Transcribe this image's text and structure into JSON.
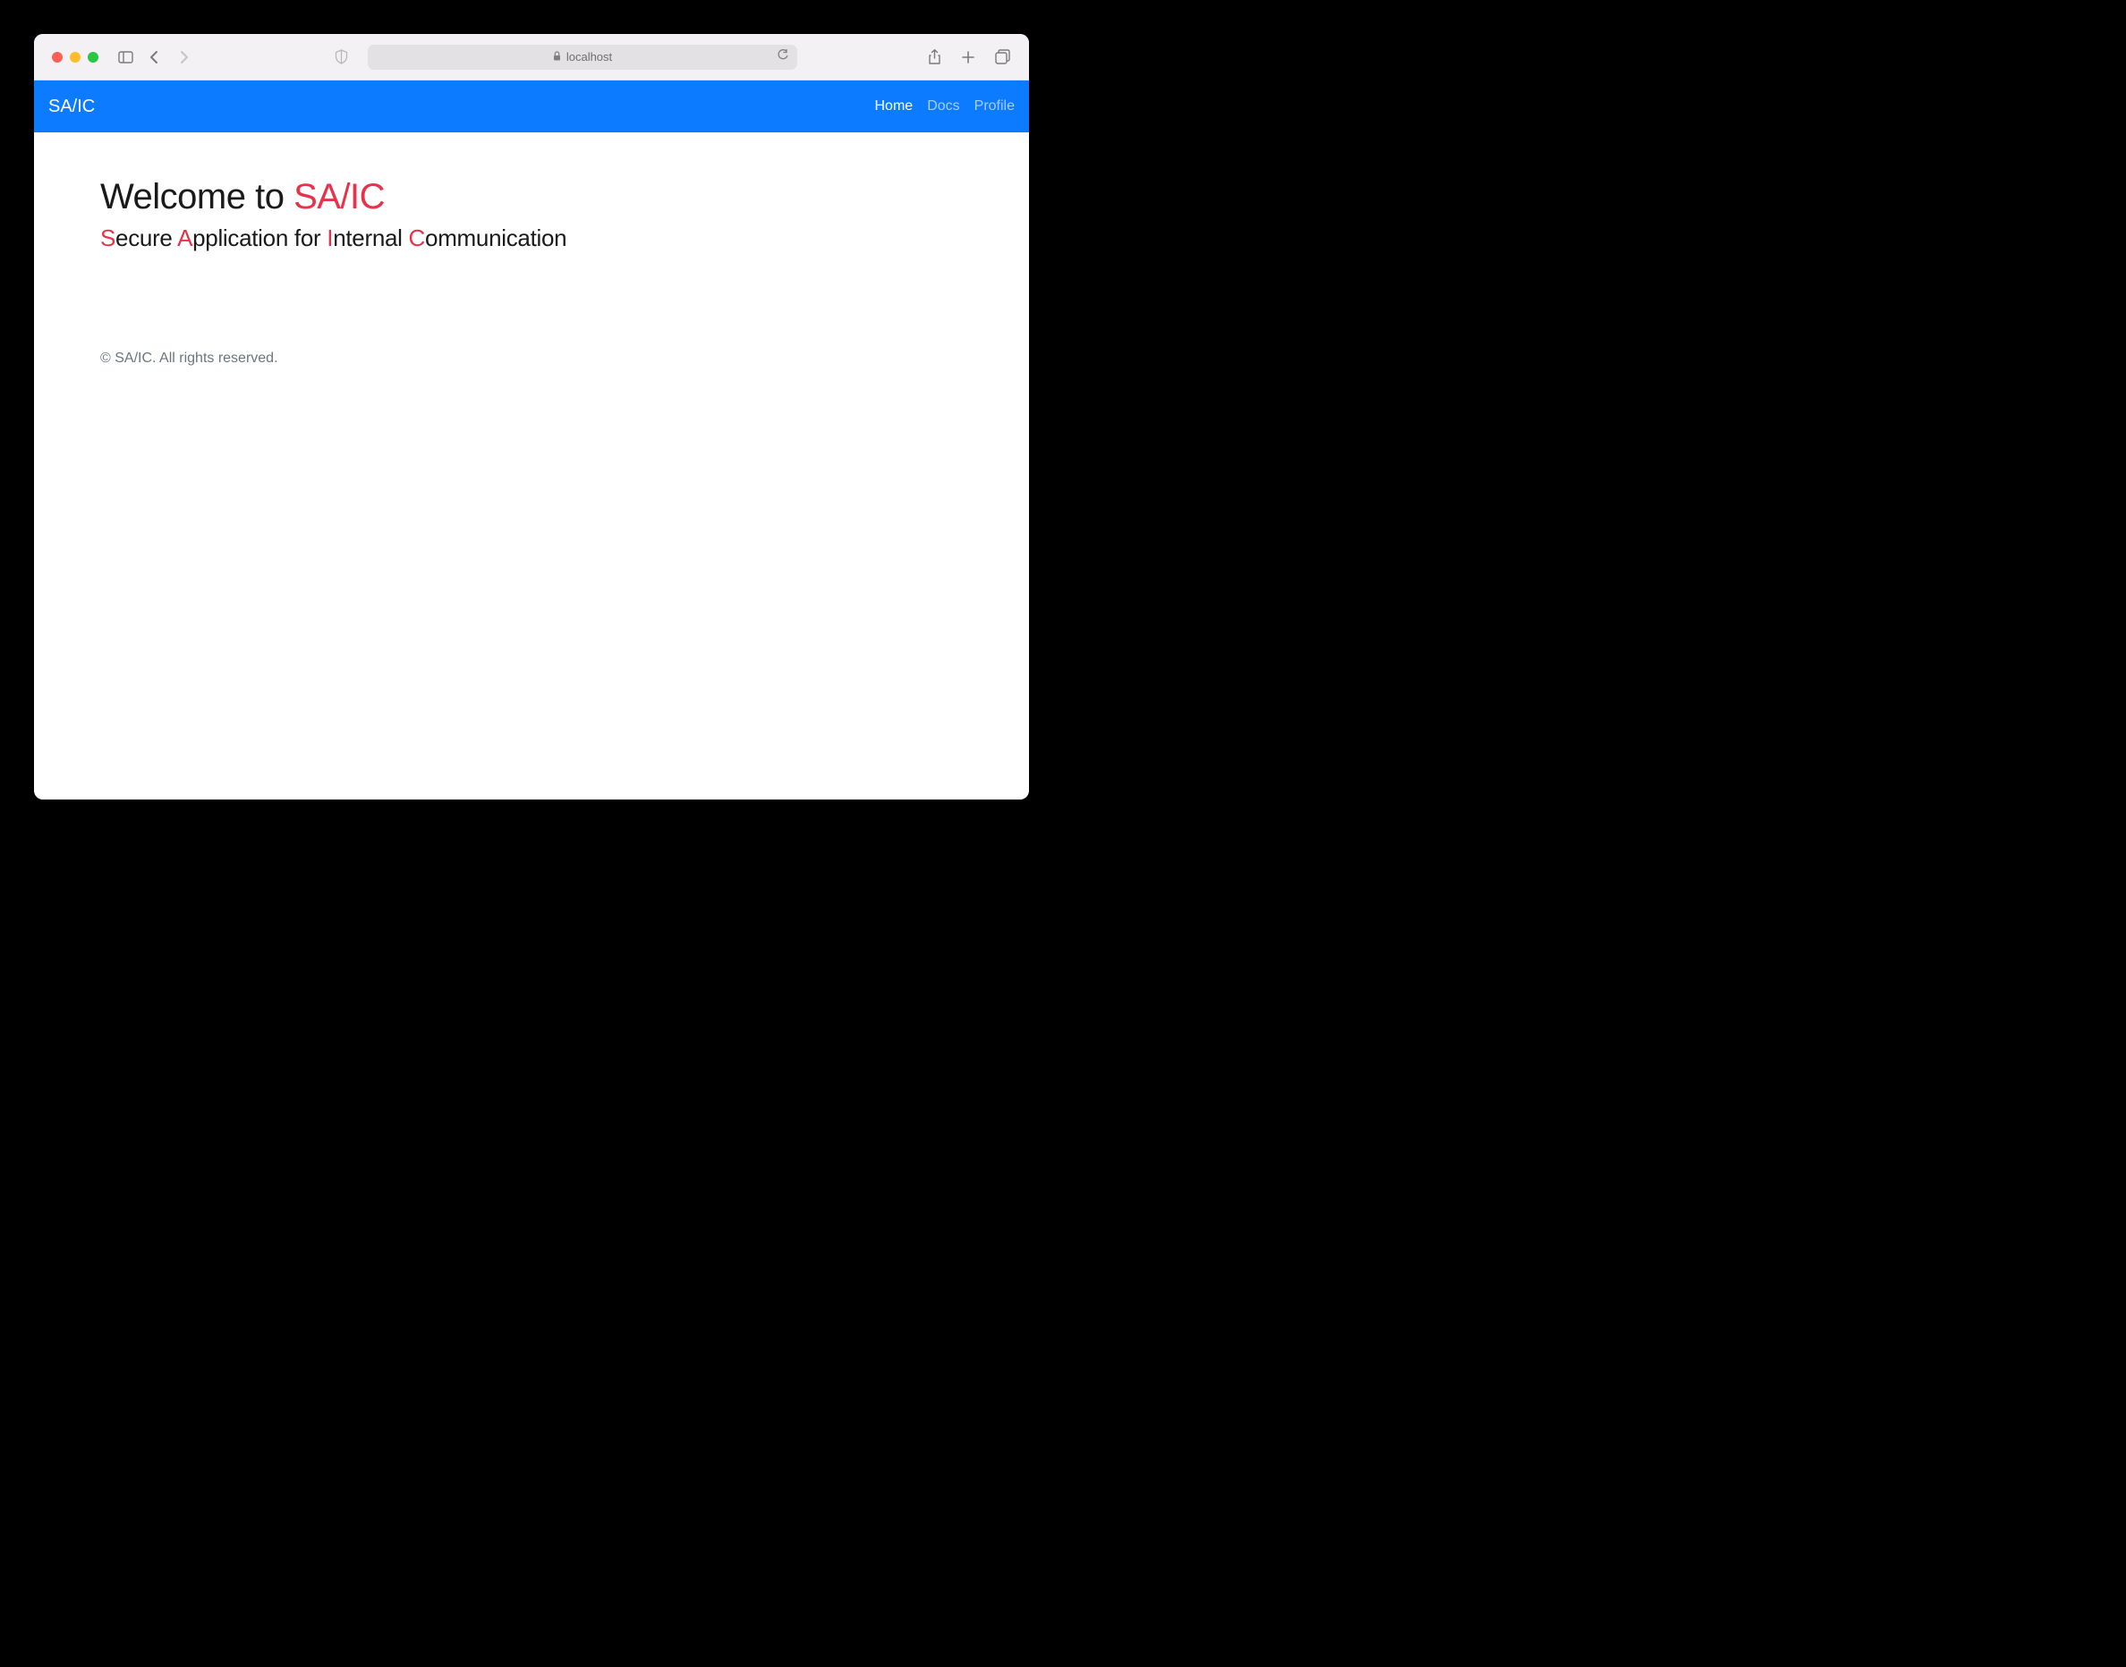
{
  "browser": {
    "url_host": "localhost"
  },
  "navbar": {
    "brand": "SA/IC",
    "links": [
      {
        "label": "Home",
        "active": true
      },
      {
        "label": "Docs",
        "active": false
      },
      {
        "label": "Profile",
        "active": false
      }
    ]
  },
  "hero": {
    "title_prefix": "Welcome to ",
    "title_accent": "SA/IC",
    "subtitle_parts": {
      "s": "S",
      "s_rest": "ecure ",
      "a": "A",
      "a_rest": "pplication for ",
      "i": "I",
      "i_rest": "nternal ",
      "c": "C",
      "c_rest": "ommunication"
    }
  },
  "footer": {
    "copyright": "© SA/IC. All rights reserved."
  },
  "colors": {
    "navbar_bg": "#0d7bff",
    "accent_red": "#e8324a"
  }
}
